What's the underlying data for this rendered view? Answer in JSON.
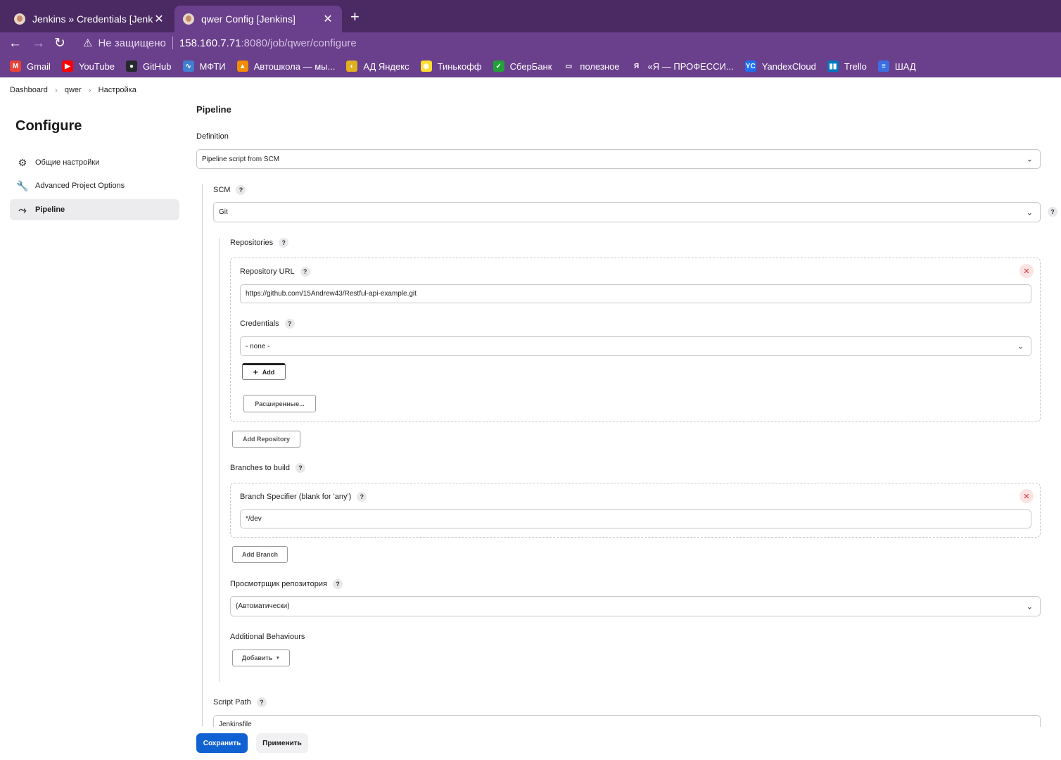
{
  "browser": {
    "tabs": [
      {
        "title": "Jenkins » Credentials [Jenkins]",
        "active": false
      },
      {
        "title": "qwer Config [Jenkins]",
        "active": true
      }
    ],
    "new_tab_icon": "+",
    "address": {
      "security_label": "Не защищено",
      "host": "158.160.7.71",
      "path": ":8080/job/qwer/configure"
    },
    "bookmarks": [
      {
        "label": "Gmail",
        "icon": "gmail-icon",
        "color": "#ea4335"
      },
      {
        "label": "YouTube",
        "icon": "youtube-icon",
        "color": "#ff0000"
      },
      {
        "label": "GitHub",
        "icon": "github-icon",
        "color": "#24292e"
      },
      {
        "label": "МФТИ",
        "icon": "mipt-icon",
        "color": "#3f7fd1"
      },
      {
        "label": "Автошкола — мы...",
        "icon": "cone-icon",
        "color": "#f28c00"
      },
      {
        "label": "АД Яндекс",
        "icon": "yandex-ad-icon",
        "color": "#e0b020"
      },
      {
        "label": "Тинькофф",
        "icon": "tinkoff-icon",
        "color": "#ffdd2d"
      },
      {
        "label": "СберБанк",
        "icon": "sber-icon",
        "color": "#21a038"
      },
      {
        "label": "полезное",
        "icon": "folder-icon",
        "color": "#6a3f8c"
      },
      {
        "label": "«Я — ПРОФЕССИ...",
        "icon": "ya-icon",
        "color": "#6a3f8c"
      },
      {
        "label": "YandexCloud",
        "icon": "yc-icon",
        "color": "#1f6ff2"
      },
      {
        "label": "Trello",
        "icon": "trello-icon",
        "color": "#0079bf"
      },
      {
        "label": "ШАД",
        "icon": "shad-icon",
        "color": "#3b6fe0"
      }
    ]
  },
  "breadcrumb": [
    "Dashboard",
    "qwer",
    "Настройка"
  ],
  "sidebar": {
    "title": "Configure",
    "items": [
      {
        "label": "Общие настройки",
        "icon": "gear-icon",
        "active": false
      },
      {
        "label": "Advanced Project Options",
        "icon": "wrench-icon",
        "active": false
      },
      {
        "label": "Pipeline",
        "icon": "pipeline-icon",
        "active": true
      }
    ]
  },
  "main": {
    "section_title": "Pipeline",
    "definition_label": "Definition",
    "definition_value": "Pipeline script from SCM",
    "scm_label": "SCM",
    "scm_value": "Git",
    "repositories_label": "Repositories",
    "repo_url_label": "Repository URL",
    "repo_url_value": "https://github.com/15Andrew43/Restful-api-example.git",
    "credentials_label": "Credentials",
    "credentials_value": "- none -",
    "add_label": "Add",
    "advanced_label": "Расширенные...",
    "add_repository_label": "Add Repository",
    "branches_label": "Branches to build",
    "branch_specifier_label": "Branch Specifier (blank for 'any')",
    "branch_specifier_value": "*/dev",
    "add_branch_label": "Add Branch",
    "repo_browser_label": "Просмотрщик репозитория",
    "repo_browser_value": "(Автоматически)",
    "additional_behaviours_label": "Additional Behaviours",
    "add_behaviour_label": "Добавить",
    "script_path_label": "Script Path",
    "script_path_value": "Jenkinsfile",
    "help_glyph": "?",
    "remove_glyph": "✕"
  },
  "footer": {
    "save_label": "Сохранить",
    "apply_label": "Применить"
  }
}
